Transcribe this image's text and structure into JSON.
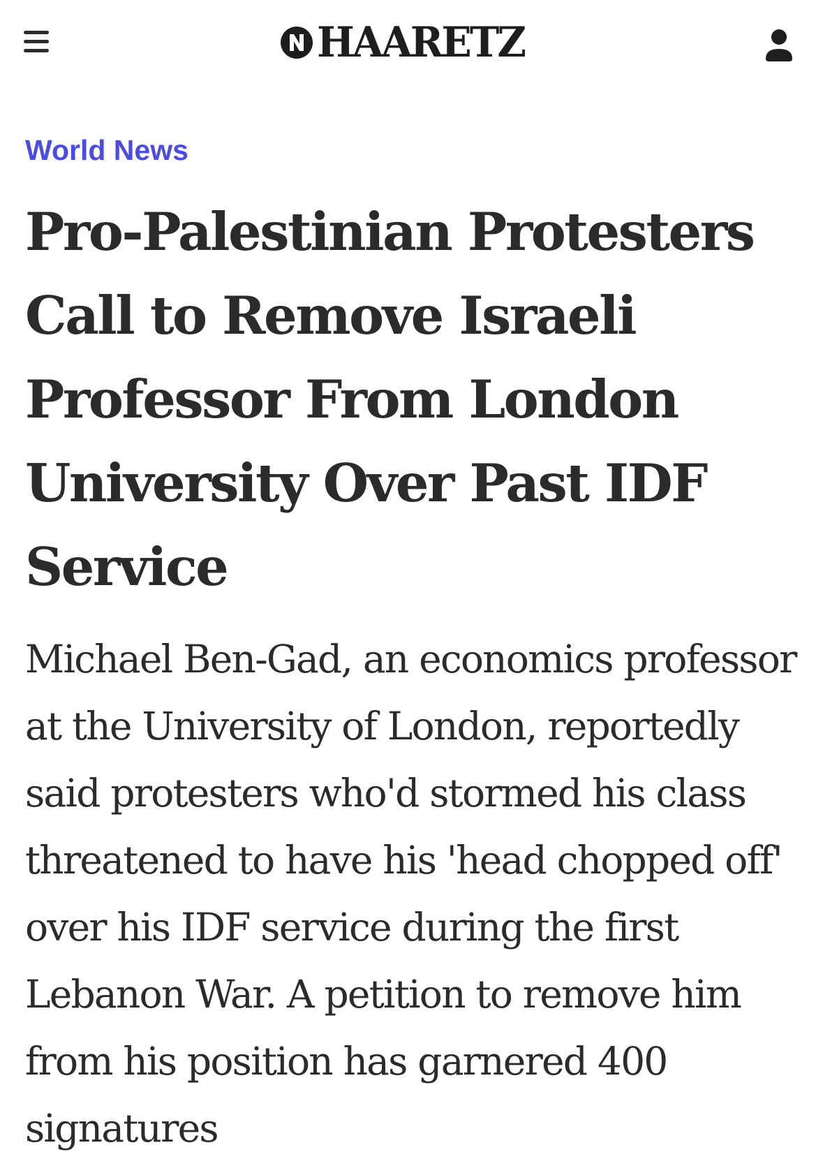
{
  "header": {
    "logo_text": "HAARETZ",
    "menu_icon": "hamburger-menu-icon",
    "account_icon": "user-account-icon"
  },
  "article": {
    "section": "World News",
    "headline": "Pro-Palestinian Protesters Call to Remove Israeli Professor From London University Over Past IDF Service",
    "dek": "Michael Ben-Gad, an economics professor at the University of London, reportedly said protesters who'd stormed his class threatened to have his 'head chopped off' over his IDF service during the first Lebanon War. A petition to remove him from his position has garnered 400 signatures"
  },
  "colors": {
    "section_accent": "#4b4be6",
    "text": "#2b2b2b",
    "background": "#ffffff"
  }
}
